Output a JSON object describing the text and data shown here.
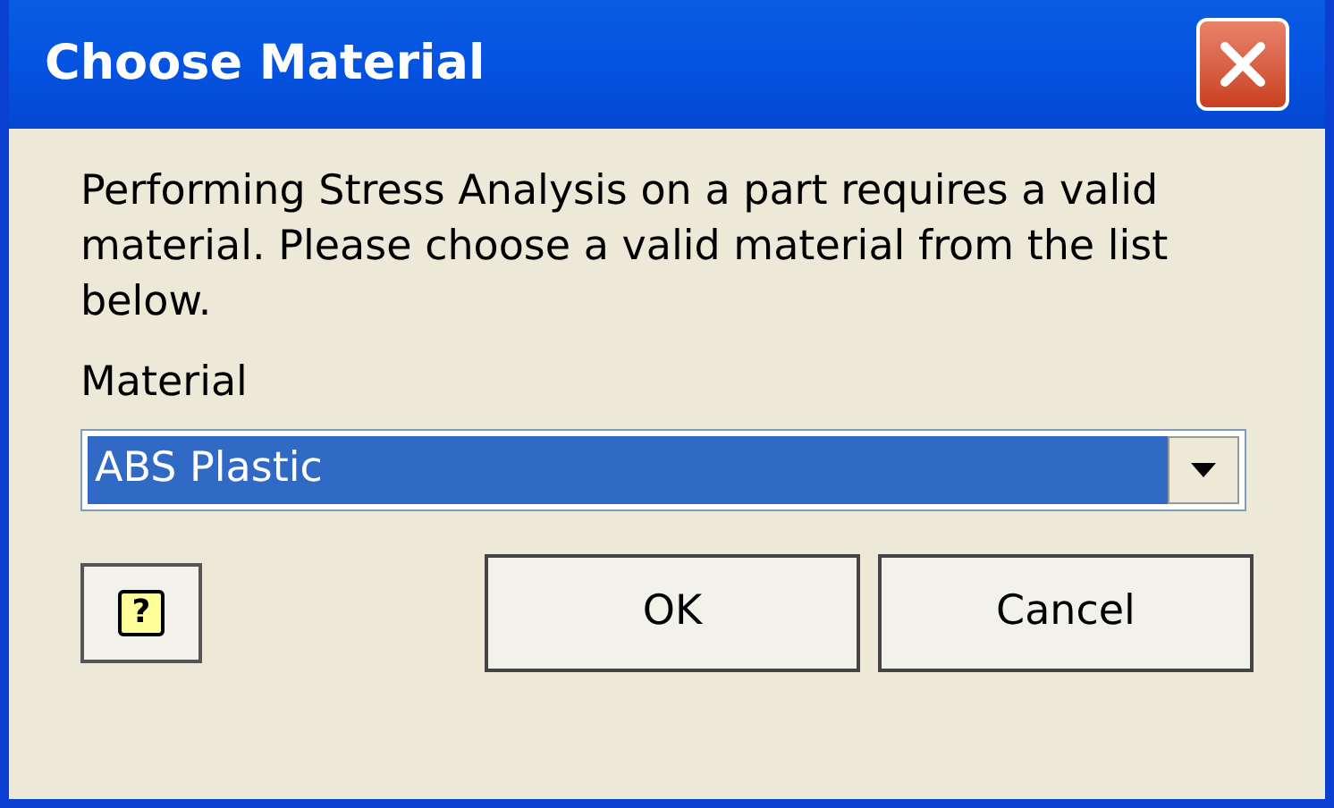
{
  "window": {
    "title": "Choose Material"
  },
  "message": "Performing Stress Analysis on a part requires a valid material. Please choose a valid material from the list below.",
  "material": {
    "label": "Material",
    "value": "ABS Plastic",
    "selected": true
  },
  "buttons": [
    {
      "kind": "help",
      "label": "?"
    },
    {
      "kind": "text",
      "label": "OK"
    },
    {
      "kind": "text",
      "label": "Cancel"
    }
  ]
}
